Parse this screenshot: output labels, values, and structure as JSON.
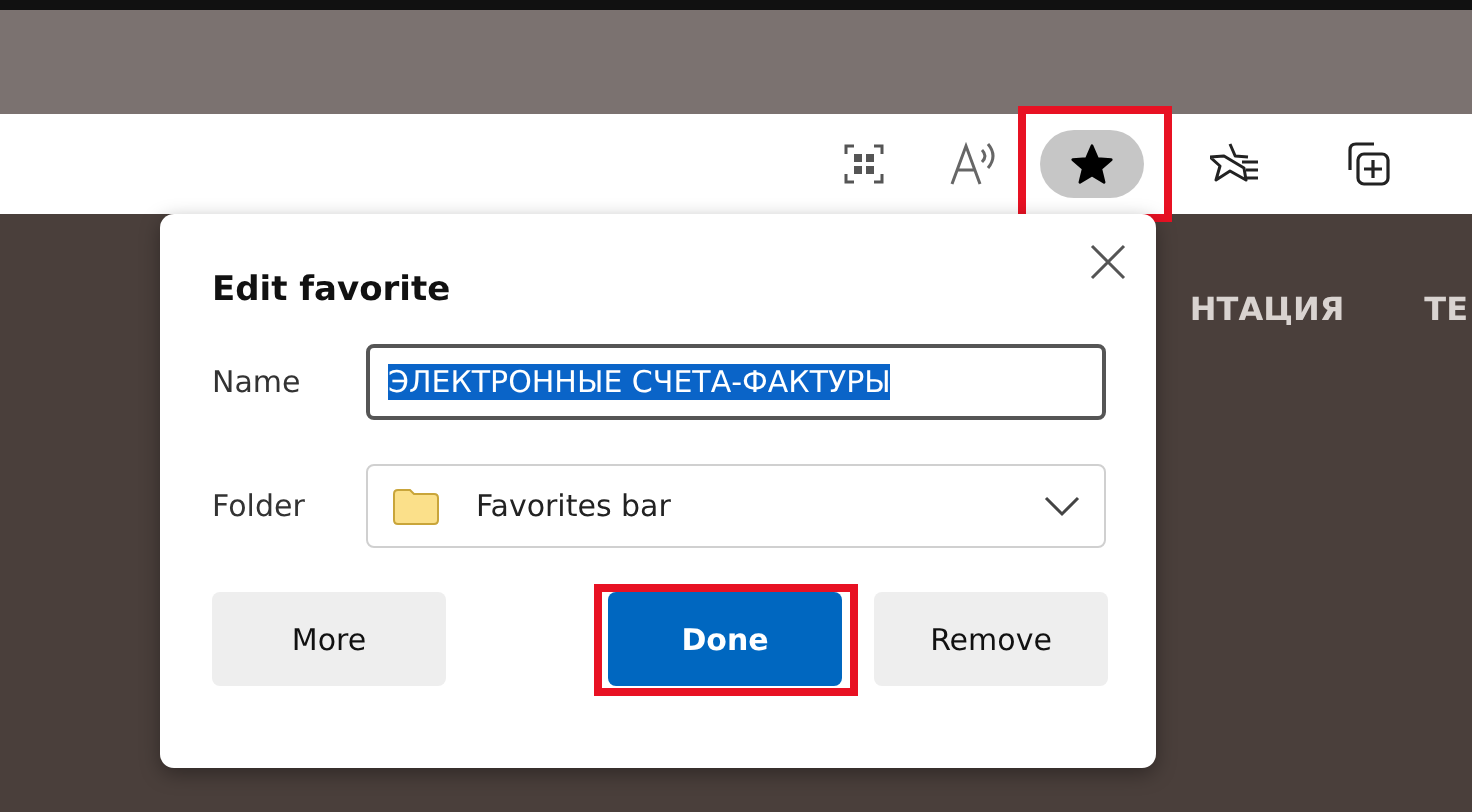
{
  "toolbar": {
    "favorite_active": true,
    "favorite_highlighted": true
  },
  "page_nav": [
    {
      "label": "НТАЦИЯ"
    },
    {
      "label": "ТЕ"
    }
  ],
  "dialog": {
    "title": "Edit favorite",
    "name_label": "Name",
    "name_value": "ЭЛЕКТРОННЫЕ СЧЕТА-ФАКТУРЫ",
    "name_selected": true,
    "folder_label": "Folder",
    "folder_value": "Favorites bar",
    "buttons": [
      {
        "label": "More",
        "kind": "secondary",
        "highlighted": false
      },
      {
        "label": "Done",
        "kind": "primary",
        "highlighted": true
      },
      {
        "label": "Remove",
        "kind": "secondary",
        "highlighted": false
      }
    ]
  }
}
